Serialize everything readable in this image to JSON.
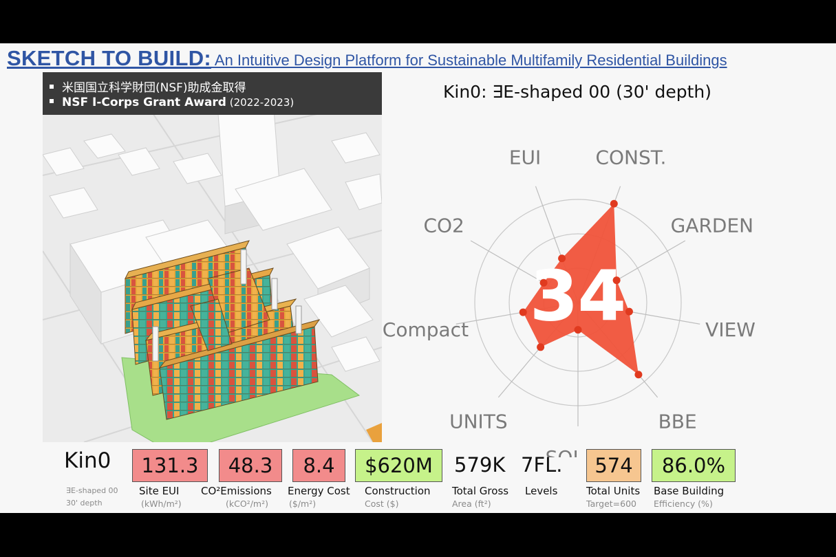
{
  "title": {
    "main": "SKETCH TO BUILD:",
    "subtitle": " An Intuitive Design Platform for Sustainable Multifamily Residential Buildings"
  },
  "grant": {
    "items": [
      {
        "text": "米国国立科学財団(NSF)助成金取得",
        "years": ""
      },
      {
        "text": "NSF I-Corps Grant Award",
        "years": " (2022-2023)"
      }
    ]
  },
  "chart_data": {
    "type": "radar",
    "title": "Kin0: ∃E-shaped 00 (30' depth)",
    "center_score": "34",
    "axes": [
      "EUI",
      "CONST.",
      "GARDEN",
      "VIEW",
      "BBE",
      "SOLAR",
      "UNITS",
      "Compact",
      "CO2"
    ],
    "values": [
      0.38,
      0.85,
      0.36,
      0.42,
      0.76,
      0.22,
      0.47,
      0.45,
      0.32
    ],
    "rings": 3,
    "fill_color": "#f0533a",
    "point_color": "#e03a1f"
  },
  "metrics": {
    "kin_name": "Kin0",
    "kin_sub1": "∃E-shaped 00",
    "kin_sub2": "30' depth",
    "site_eui": {
      "value": "131.3",
      "label": "Site EUI",
      "unit": "(kWh/m²)",
      "color": "red"
    },
    "emissions": {
      "value": "48.3",
      "label": "CO²Emissions",
      "unit": "(kCO²/m²)",
      "color": "red"
    },
    "energy_cost": {
      "value": "8.4",
      "label": "Energy Cost",
      "unit": "($/m²)",
      "color": "red"
    },
    "construction": {
      "value": "$620M",
      "label": "Construction",
      "unit": "Cost ($)",
      "color": "green"
    },
    "total_gross": {
      "value": "579K",
      "label": "Total Gross",
      "unit": "Area (ft²)"
    },
    "levels": {
      "value": "7FL.",
      "label": "Levels"
    },
    "total_units": {
      "value": "574",
      "label": "Total Units",
      "unit": "Target=600",
      "color": "orange"
    },
    "bbe": {
      "value": "86.0%",
      "label": "Base Building",
      "unit": "Efficiency (%)",
      "color": "green"
    }
  }
}
